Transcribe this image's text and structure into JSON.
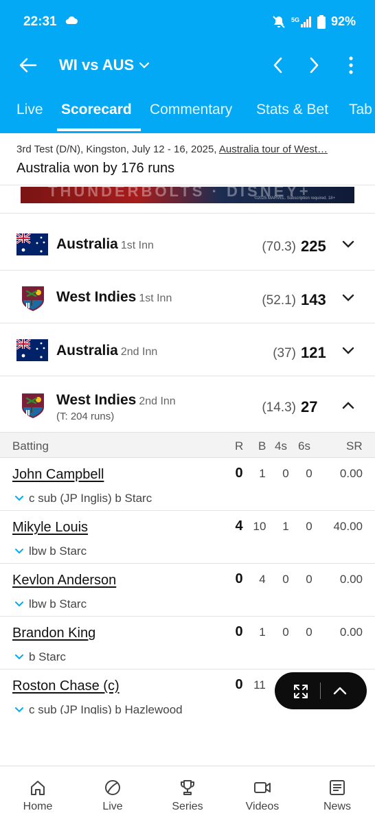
{
  "status_bar": {
    "time": "22:31",
    "network": "5G",
    "battery": "92%"
  },
  "app_bar": {
    "title": "WI vs AUS"
  },
  "tabs": [
    {
      "label": "Live"
    },
    {
      "label": "Scorecard"
    },
    {
      "label": "Commentary"
    },
    {
      "label": "Stats & Bet"
    },
    {
      "label": "Tab"
    }
  ],
  "match": {
    "meta": "3rd Test (D/N), Kingston, July 12 - 16, 2025, ",
    "series_link": "Australia tour of West…",
    "result": "Australia won by 176 runs"
  },
  "ad": {
    "fine_print": "©2025 MARVEL. Subscription required. 18+"
  },
  "innings": [
    {
      "team": "Australia",
      "label": "1st Inn",
      "overs": "(70.3)",
      "score": "225"
    },
    {
      "team": "West Indies",
      "label": "1st Inn",
      "overs": "(52.1)",
      "score": "143"
    },
    {
      "team": "Australia",
      "label": "2nd Inn",
      "overs": "(37)",
      "score": "121"
    },
    {
      "team": "West Indies",
      "label": "2nd Inn",
      "target": "(T: 204 runs)",
      "overs": "(14.3)",
      "score": "27"
    }
  ],
  "batting": {
    "headers": {
      "batting": "Batting",
      "r": "R",
      "b": "B",
      "fours": "4s",
      "sixes": "6s",
      "sr": "SR"
    },
    "rows": [
      {
        "name": "John Campbell",
        "dismissal": "c sub (JP Inglis) b Starc",
        "r": "0",
        "b": "1",
        "fours": "0",
        "sixes": "0",
        "sr": "0.00"
      },
      {
        "name": "Mikyle Louis",
        "dismissal": "lbw b Starc",
        "r": "4",
        "b": "10",
        "fours": "1",
        "sixes": "0",
        "sr": "40.00"
      },
      {
        "name": "Kevlon Anderson",
        "dismissal": "lbw b Starc",
        "r": "0",
        "b": "4",
        "fours": "0",
        "sixes": "0",
        "sr": "0.00"
      },
      {
        "name": "Brandon King",
        "dismissal": "b Starc",
        "r": "0",
        "b": "1",
        "fours": "0",
        "sixes": "0",
        "sr": "0.00"
      },
      {
        "name": "Roston Chase (c)",
        "dismissal": "c sub (JP Inglis) b Hazlewood",
        "r": "0",
        "b": "11"
      }
    ]
  },
  "bottom_nav": [
    {
      "label": "Home",
      "icon": "home-icon"
    },
    {
      "label": "Live",
      "icon": "ball-icon"
    },
    {
      "label": "Series",
      "icon": "trophy-icon"
    },
    {
      "label": "Videos",
      "icon": "video-icon"
    },
    {
      "label": "News",
      "icon": "news-icon"
    }
  ],
  "colors": {
    "primary": "#03a9f4",
    "text": "#111111",
    "accent_chevron": "#03a9f4"
  }
}
